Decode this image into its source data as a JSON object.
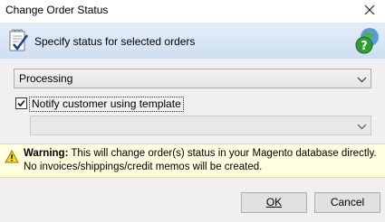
{
  "window": {
    "title": "Change Order Status"
  },
  "header": {
    "label": "Specify status for selected orders"
  },
  "status_select": {
    "value": "Processing"
  },
  "notify": {
    "label": "Notify customer using template",
    "checked": true
  },
  "template_select": {
    "value": ""
  },
  "warning": {
    "prefix": "Warning:",
    "text": " This will change order(s) status in your Magento database directly. No invoices/shippings/credit memos will be created."
  },
  "buttons": {
    "ok": "OK",
    "cancel": "Cancel"
  },
  "icons": [
    "clipboard-check-icon",
    "help-globe-icon",
    "close-icon",
    "chevron-down-icon",
    "warning-icon"
  ],
  "colors": {
    "header_bg": "#d9e6f5",
    "warning_bg": "#ffffe1",
    "body_bg": "#f0f0f0"
  }
}
